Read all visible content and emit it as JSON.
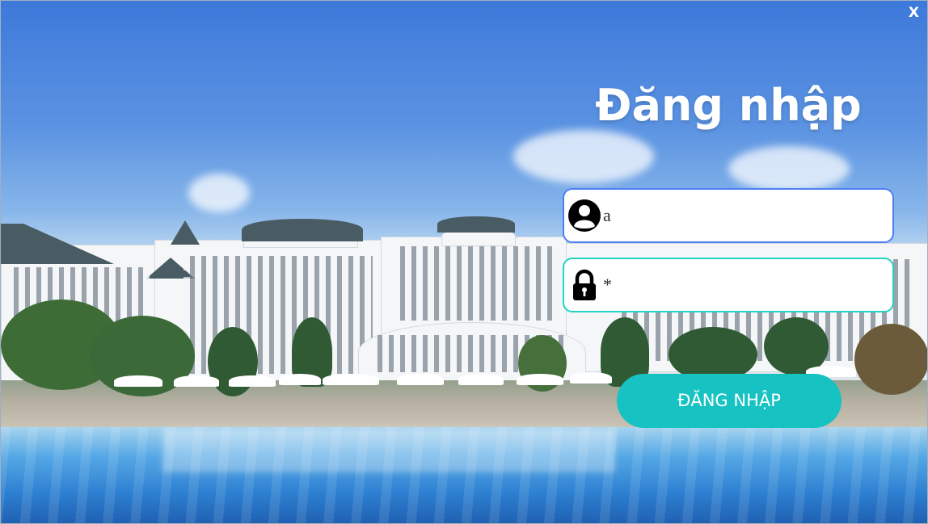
{
  "window": {
    "close_label": "X"
  },
  "login": {
    "title": "Đăng nhập",
    "username": {
      "icon": "user-circle-icon",
      "value": "a"
    },
    "password": {
      "icon": "lock-icon",
      "value": "*"
    },
    "submit_label": "ĐĂNG NHẬP"
  },
  "colors": {
    "field_border": "#4f7ef2",
    "field_border_focus": "#22d4c4",
    "button_background": "#17c2c2",
    "title_text": "#ffffff"
  },
  "background": {
    "description_icon": "resort-pool-photo"
  }
}
